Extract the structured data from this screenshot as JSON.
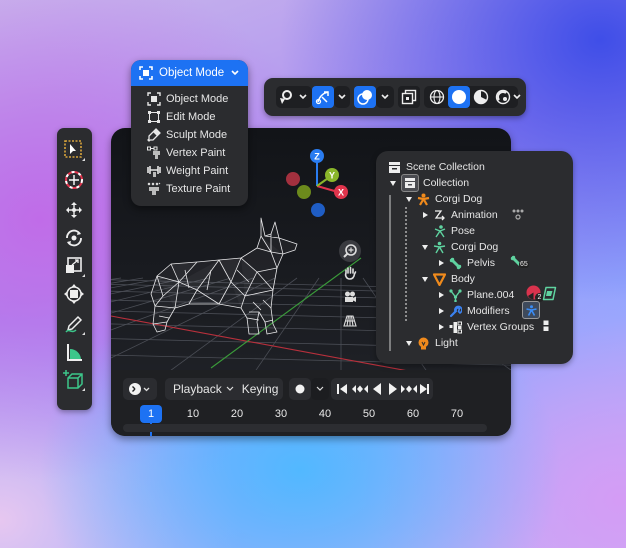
{
  "mode_menu": {
    "selected": "Object Mode",
    "items": [
      {
        "label": "Object Mode",
        "icon": "object-mode-icon"
      },
      {
        "label": "Edit Mode",
        "icon": "edit-mode-icon"
      },
      {
        "label": "Sculpt Mode",
        "icon": "sculpt-mode-icon"
      },
      {
        "label": "Vertex Paint",
        "icon": "vertex-paint-icon"
      },
      {
        "label": "Weight Paint",
        "icon": "weight-paint-icon"
      },
      {
        "label": "Texture Paint",
        "icon": "texture-paint-icon"
      }
    ]
  },
  "top_toolbar": {
    "items": [
      "view-object-types",
      "gizmo-toggle",
      "overlays-toggle",
      "xray-toggle",
      "wireframe-shading",
      "solid-shading",
      "material-preview-shading",
      "rendered-shading"
    ],
    "active": [
      "gizmo-toggle",
      "overlays-toggle",
      "solid-shading"
    ]
  },
  "left_toolbar": {
    "tools": [
      "select-box",
      "cursor",
      "move",
      "rotate",
      "scale",
      "transform",
      "annotate",
      "measure",
      "add-cube"
    ],
    "active": "select-box"
  },
  "gizmo": {
    "x_label": "X",
    "y_label": "Y",
    "z_label": "Z"
  },
  "outliner": {
    "rows": [
      {
        "label": "Scene Collection",
        "icon": "scene-collection-icon"
      },
      {
        "label": "Collection",
        "icon": "collection-icon",
        "expanded": true
      },
      {
        "label": "Corgi Dog",
        "icon": "armature-object-icon",
        "expanded": true
      },
      {
        "label": "Animation",
        "icon": "animation-icon",
        "expanded": false
      },
      {
        "label": "Pose",
        "icon": "pose-icon"
      },
      {
        "label": "Corgi Dog",
        "icon": "armature-data-icon",
        "expanded": true
      },
      {
        "label": "Pelvis",
        "icon": "bone-icon",
        "expanded": false,
        "badge": "65"
      },
      {
        "label": "Body",
        "icon": "mesh-object-icon",
        "expanded": true
      },
      {
        "label": "Plane.004",
        "icon": "mesh-data-icon",
        "expanded": false,
        "badge": "2"
      },
      {
        "label": "Modifiers",
        "icon": "wrench-icon",
        "expanded": false
      },
      {
        "label": "Vertex Groups",
        "icon": "vertex-groups-icon",
        "expanded": false
      },
      {
        "label": "Light",
        "icon": "light-icon",
        "expanded": true
      }
    ]
  },
  "timeline": {
    "playback_label": "Playback",
    "keying_label": "Keying",
    "current_frame": "1",
    "frames": [
      "10",
      "20",
      "30",
      "40",
      "50",
      "60",
      "70"
    ]
  },
  "colors": {
    "accent": "#1d72f3",
    "axis_x": "#e0344c",
    "axis_y": "#8ab62a",
    "axis_z": "#2a7cf0",
    "object_orange": "#f08a1c",
    "data_green": "#5fd3a0"
  }
}
